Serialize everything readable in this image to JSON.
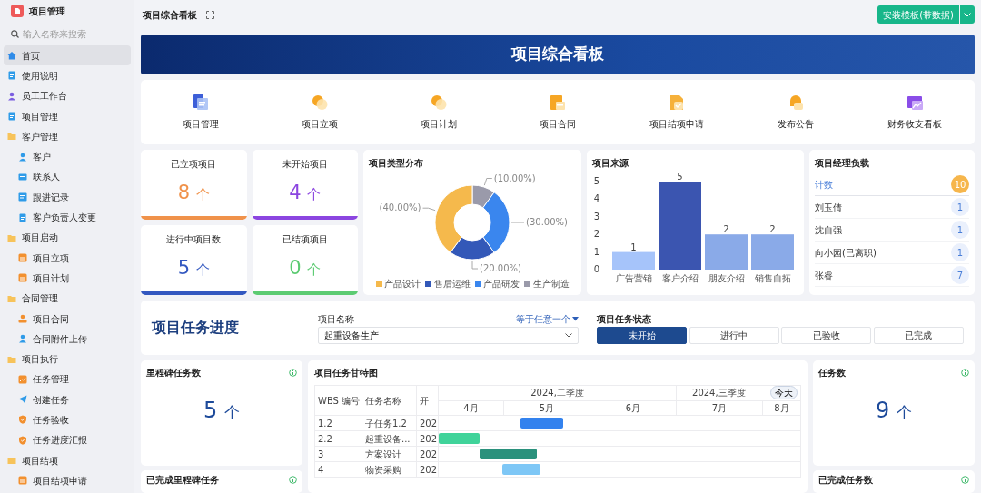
{
  "app": {
    "title": "项目管理",
    "search": {
      "placeholder": "输入名称来搜索"
    }
  },
  "sidebar": {
    "items": [
      {
        "label": "首页",
        "kind": "home",
        "selected": true
      },
      {
        "label": "使用说明",
        "kind": "doc",
        "selected": false
      },
      {
        "label": "员工工作台",
        "kind": "staff",
        "selected": false
      },
      {
        "label": "项目管理",
        "kind": "doc",
        "selected": false
      },
      {
        "label": "客户管理",
        "kind": "folder",
        "selected": false,
        "children": [
          {
            "label": "客户",
            "kind": "user",
            "selected": false
          },
          {
            "label": "联系人",
            "kind": "card",
            "selected": false
          },
          {
            "label": "跟进记录",
            "kind": "form",
            "selected": false
          },
          {
            "label": "客户负责人变更",
            "kind": "doc",
            "selected": false
          }
        ]
      },
      {
        "label": "项目启动",
        "kind": "folder",
        "selected": false,
        "children": [
          {
            "label": "项目立项",
            "kind": "sheet",
            "selected": false
          },
          {
            "label": "项目计划",
            "kind": "sheet",
            "selected": false
          }
        ]
      },
      {
        "label": "合同管理",
        "kind": "folder",
        "selected": false,
        "children": [
          {
            "label": "项目合同",
            "kind": "stamp",
            "selected": false
          },
          {
            "label": "合同附件上传",
            "kind": "user",
            "selected": false
          }
        ]
      },
      {
        "label": "项目执行",
        "kind": "folder",
        "selected": false,
        "children": [
          {
            "label": "任务管理",
            "kind": "chart",
            "selected": false
          },
          {
            "label": "创建任务",
            "kind": "send",
            "selected": false
          },
          {
            "label": "任务验收",
            "kind": "shield",
            "selected": false
          },
          {
            "label": "任务进度汇报",
            "kind": "shield",
            "selected": false
          }
        ]
      },
      {
        "label": "项目结项",
        "kind": "folder",
        "selected": false,
        "children": [
          {
            "label": "项目结项申请",
            "kind": "sheet",
            "selected": false
          }
        ]
      }
    ]
  },
  "topbar": {
    "title": "项目综合看板",
    "install_button": "安装模板(带数据)"
  },
  "banner": {
    "title": "项目综合看板"
  },
  "shortcuts": [
    {
      "label": "项目管理",
      "kind": "doc"
    },
    {
      "label": "项目立项",
      "kind": "bubble"
    },
    {
      "label": "项目计划",
      "kind": "bubble"
    },
    {
      "label": "项目合同",
      "kind": "contract"
    },
    {
      "label": "项目结项申请",
      "kind": "check"
    },
    {
      "label": "发布公告",
      "kind": "bell"
    },
    {
      "label": "财务收支看板",
      "kind": "trend"
    }
  ],
  "stats": [
    {
      "label": "已立项项目",
      "value": "8",
      "unit": "个",
      "color": "#f0924a"
    },
    {
      "label": "未开始项目",
      "value": "4",
      "unit": "个",
      "color": "#8b45e0"
    },
    {
      "label": "进行中项目数",
      "value": "5",
      "unit": "个",
      "color": "#3358c0"
    },
    {
      "label": "已结项项目",
      "value": "0",
      "unit": "个",
      "color": "#5ccb72"
    }
  ],
  "type_chart": {
    "title": "项目类型分布",
    "chart_data": {
      "type": "donut",
      "categories": [
        "产品设计",
        "售后运维",
        "产品研发",
        "生产制造"
      ],
      "values": [
        40,
        20,
        30,
        10
      ],
      "colors": [
        "#f5b94c",
        "#3358b8",
        "#3a86ee",
        "#9a9aaa"
      ],
      "value_labels": [
        "(40.00%)",
        "(20.00%)",
        "(30.00%)",
        "(10.00%)"
      ]
    }
  },
  "source_chart": {
    "title": "项目来源",
    "chart_data": {
      "type": "bar",
      "categories": [
        "广告营销",
        "客户介绍",
        "朋友介绍",
        "销售自拓"
      ],
      "values": [
        1,
        5,
        2,
        2
      ],
      "colors": [
        "#a6c4fa",
        "#3b55b0",
        "#8aaae8",
        "#8aaae8"
      ],
      "yticks": [
        0,
        1,
        2,
        3,
        4,
        5
      ],
      "ylim": [
        0,
        5
      ],
      "data_labels": true
    }
  },
  "managers": {
    "title": "项目经理负载",
    "total": {
      "label": "计数",
      "count": "10"
    },
    "rows": [
      {
        "name": "刘玉倩",
        "count": "1"
      },
      {
        "name": "沈自强",
        "count": "1"
      },
      {
        "name": "向小园(已离职)",
        "count": "1"
      },
      {
        "name": "张睿",
        "count": "7"
      }
    ]
  },
  "progress": {
    "title": "项目任务进度",
    "project_label": "项目名称",
    "filter_mode": "等于任意一个",
    "project_value": "起重设备生产",
    "status_label": "项目任务状态",
    "statuses": [
      {
        "label": "未开始",
        "selected": true
      },
      {
        "label": "进行中",
        "selected": false
      },
      {
        "label": "已验收",
        "selected": false
      },
      {
        "label": "已完成",
        "selected": false
      }
    ]
  },
  "milestones": {
    "title": "里程碑任务数",
    "value": "5",
    "unit": "个"
  },
  "done_milestones": {
    "title": "已完成里程碑任务"
  },
  "tasks": {
    "title": "任务数",
    "value": "9",
    "unit": "个"
  },
  "done_tasks": {
    "title": "已完成任务数"
  },
  "gantt": {
    "title": "项目任务甘特图",
    "columns": [
      "WBS 编号",
      "任务名称",
      "开"
    ],
    "quarters": [
      "2024,二季度",
      "2024,三季度"
    ],
    "months": [
      "4月",
      "5月",
      "6月",
      "7月",
      "8月"
    ],
    "today_button": "今天",
    "rows": [
      {
        "wbs": "1.2",
        "name": "子任务1.2",
        "start": "202",
        "bar": {
          "color": "#3382ee"
        }
      },
      {
        "wbs": "2.2",
        "name": "起重设备...",
        "start": "202",
        "bar": {
          "color": "#40d39a"
        }
      },
      {
        "wbs": "3",
        "name": "方案设计",
        "start": "202",
        "bar": {
          "color": "#2a917c"
        }
      },
      {
        "wbs": "4",
        "name": "物资采购",
        "start": "202",
        "bar": {
          "color": "#7ec7f6"
        }
      }
    ]
  }
}
